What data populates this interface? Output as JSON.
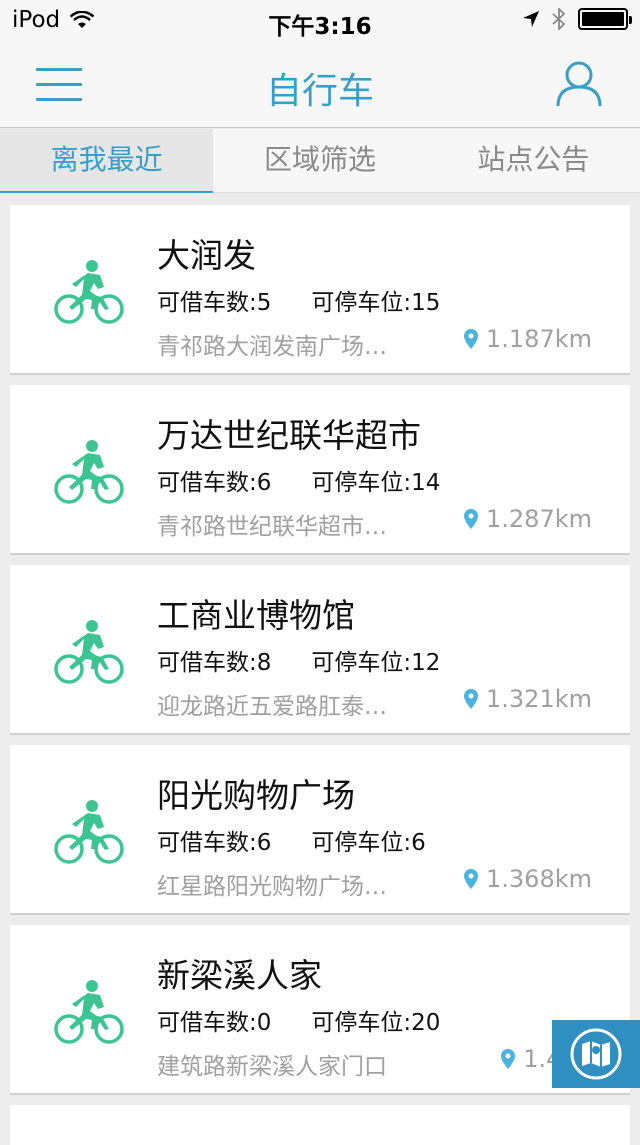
{
  "status_bar": {
    "carrier": "iPod",
    "time": "下午3:16"
  },
  "header": {
    "title": "自行车"
  },
  "tabs": [
    {
      "label": "离我最近",
      "active": true
    },
    {
      "label": "区域筛选",
      "active": false
    },
    {
      "label": "站点公告",
      "active": false
    }
  ],
  "stations": [
    {
      "name": "大润发",
      "borrow_label": "可借车数:5",
      "park_label": "可停车位:15",
      "address": "青祁路大润发南广场…",
      "distance": "1.187km"
    },
    {
      "name": "万达世纪联华超市",
      "borrow_label": "可借车数:6",
      "park_label": "可停车位:14",
      "address": "青祁路世纪联华超市…",
      "distance": "1.287km"
    },
    {
      "name": "工商业博物馆",
      "borrow_label": "可借车数:8",
      "park_label": "可停车位:12",
      "address": "迎龙路近五爱路肛泰…",
      "distance": "1.321km"
    },
    {
      "name": "阳光购物广场",
      "borrow_label": "可借车数:6",
      "park_label": "可停车位:6",
      "address": "红星路阳光购物广场…",
      "distance": "1.368km"
    },
    {
      "name": "新梁溪人家",
      "borrow_label": "可借车数:0",
      "park_label": "可停车位:20",
      "address": "建筑路新梁溪人家门口",
      "distance": "1.403"
    }
  ],
  "colors": {
    "accent": "#3a9fc8",
    "bike_icon": "#3cc593",
    "pin": "#4ab4e0",
    "map_button": "#2e8fc0"
  },
  "icons": {
    "menu": "menu-icon",
    "user": "user-icon",
    "bike": "bicycle-rider-icon",
    "pin": "location-pin-icon",
    "map": "map-icon"
  }
}
